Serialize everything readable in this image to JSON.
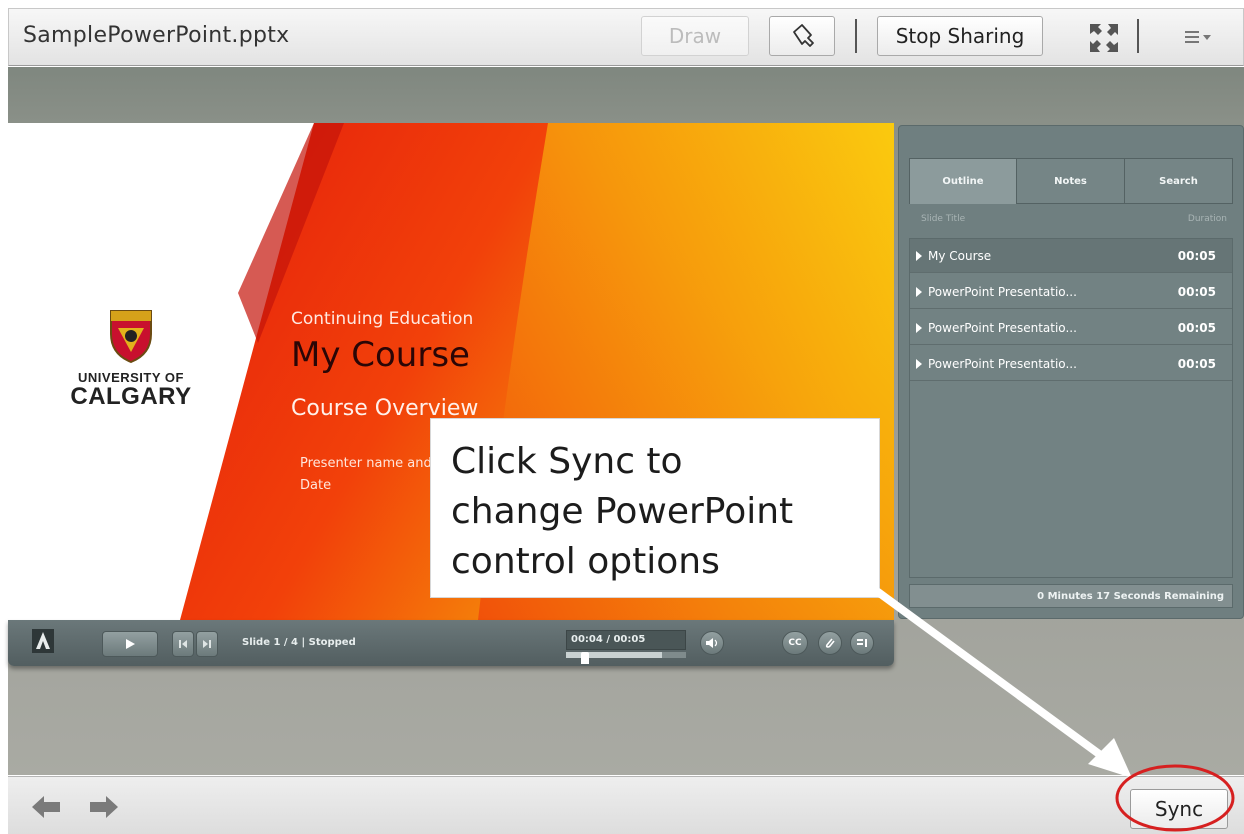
{
  "header": {
    "title": "SamplePowerPoint.pptx",
    "draw_label": "Draw",
    "stop_sharing_label": "Stop Sharing",
    "pointer_icon": "pointer-icon",
    "fullscreen_icon": "fullscreen-icon",
    "menu_icon": "menu-icon"
  },
  "slide": {
    "logo_line1": "UNIVERSITY OF",
    "logo_line2": "CALGARY",
    "subtitle": "Continuing Education",
    "title": "My Course",
    "overview": "Course Overview",
    "presenter": "Presenter name and",
    "date": "Date"
  },
  "player": {
    "status": "Slide 1 / 4 | Stopped",
    "time": "00:04 / 00:05",
    "cc_label": "CC",
    "progress_fraction": 0.8
  },
  "panel": {
    "tabs": [
      "Outline",
      "Notes",
      "Search"
    ],
    "col_title": "Slide Title",
    "col_duration": "Duration",
    "rows": [
      {
        "label": "My Course",
        "duration": "00:05"
      },
      {
        "label": "PowerPoint Presentatio...",
        "duration": "00:05"
      },
      {
        "label": "PowerPoint Presentatio...",
        "duration": "00:05"
      },
      {
        "label": "PowerPoint Presentatio...",
        "duration": "00:05"
      }
    ],
    "remaining": "0 Minutes 17 Seconds Remaining"
  },
  "callout": {
    "line1": "Click Sync to",
    "line2": "change PowerPoint",
    "line3": "control options"
  },
  "footer": {
    "sync_label": "Sync",
    "prev_icon": "arrow-left-icon",
    "next_icon": "arrow-right-icon"
  },
  "colors": {
    "annotation_circle": "#d62020",
    "arrow": "#ffffff",
    "slide_red": "#e8200c",
    "slide_yellow": "#f6c400"
  }
}
